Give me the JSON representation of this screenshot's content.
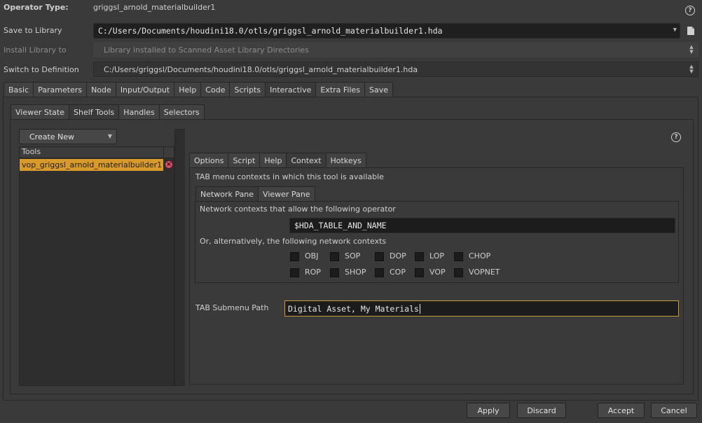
{
  "header": {
    "operator_type_label": "Operator Type:",
    "operator_type_value": "griggsl_arnold_materialbuilder1",
    "save_to_library_label": "Save to Library",
    "save_to_library_value": "C:/Users/Documents/houdini18.0/otls/griggsl_arnold_materialbuilder1.hda",
    "install_library_label": "Install Library to",
    "install_library_value": "Library installed to Scanned Asset Library Directories",
    "switch_definition_label": "Switch to Definition",
    "switch_definition_value": "C:/Users/griggsl/Documents/houdini18.0/otls/griggsl_arnold_materialbuilder1.hda"
  },
  "main_tabs": [
    "Basic",
    "Parameters",
    "Node",
    "Input/Output",
    "Help",
    "Code",
    "Scripts",
    "Interactive",
    "Extra Files",
    "Save"
  ],
  "main_tab_active": "Interactive",
  "sub_tabs": [
    "Viewer State",
    "Shelf Tools",
    "Handles",
    "Selectors"
  ],
  "sub_tab_active": "Shelf Tools",
  "tools_panel": {
    "create_new_label": "Create New",
    "header": "Tools",
    "items": [
      "vop_griggsl_arnold_materialbuilder1"
    ]
  },
  "tool_tabs": [
    "Options",
    "Script",
    "Help",
    "Context",
    "Hotkeys"
  ],
  "tool_tab_active": "Context",
  "context": {
    "description": "TAB menu contexts in which this tool is available",
    "pane_tabs": [
      "Network Pane",
      "Viewer Pane"
    ],
    "pane_tab_active": "Network Pane",
    "network_label": "Network contexts that allow the following operator",
    "network_value": "$HDA_TABLE_AND_NAME",
    "alt_label": "Or, alternatively, the following network contexts",
    "contexts_row1": [
      "OBJ",
      "SOP",
      "DOP",
      "LOP",
      "CHOP"
    ],
    "contexts_row2": [
      "ROP",
      "SHOP",
      "COP",
      "VOP",
      "VOPNET"
    ],
    "submenu_label": "TAB Submenu Path",
    "submenu_value": "Digital Asset, My Materials"
  },
  "footer": {
    "apply": "Apply",
    "discard": "Discard",
    "accept": "Accept",
    "cancel": "Cancel"
  },
  "colors": {
    "selected_item": "#d89a2a",
    "delete_icon": "#d4546a",
    "focus_border": "#c99a3c"
  }
}
